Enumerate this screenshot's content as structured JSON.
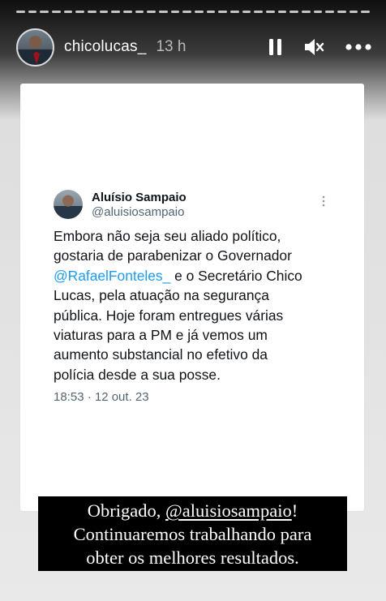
{
  "story": {
    "username": "chicolucas_",
    "time_ago": "13 h",
    "progress_segments": 30
  },
  "controls": {
    "pause_icon": "pause-icon",
    "mute_icon": "muted-speaker-icon",
    "more_icon": "more-icon"
  },
  "tweet": {
    "author_name": "Aluísio Sampaio",
    "author_handle": "@aluisiosampaio",
    "lines": [
      {
        "pre": "Embora não seja seu aliado político,",
        "mention": "",
        "post": ""
      },
      {
        "pre": "gostaria de parabenizar o Governador",
        "mention": "",
        "post": ""
      },
      {
        "pre": "",
        "mention": "@RafaelFonteles_",
        "post": " e o Secretário Chico"
      },
      {
        "pre": "Lucas, pela atuação na segurança",
        "mention": "",
        "post": ""
      },
      {
        "pre": "pública. Hoje foram entregues várias",
        "mention": "",
        "post": ""
      },
      {
        "pre": "viaturas para a PM e já vemos um",
        "mention": "",
        "post": ""
      },
      {
        "pre": "aumento substancial no efetivo da",
        "mention": "",
        "post": ""
      },
      {
        "pre": "polícia desde a sua posse.",
        "mention": "",
        "post": ""
      }
    ],
    "meta": "18:53 · 12 out. 23"
  },
  "caption": {
    "line1_pre": "Obrigado, ",
    "line1_handle": "@aluisiosampaio",
    "line1_post": "!",
    "line2": "Continuaremos trabalhando para",
    "line3": "obter os melhores resultados."
  },
  "colors": {
    "mention": "#1d9bf0",
    "caption_bg": "#000000",
    "card_bg": "#ffffff"
  }
}
